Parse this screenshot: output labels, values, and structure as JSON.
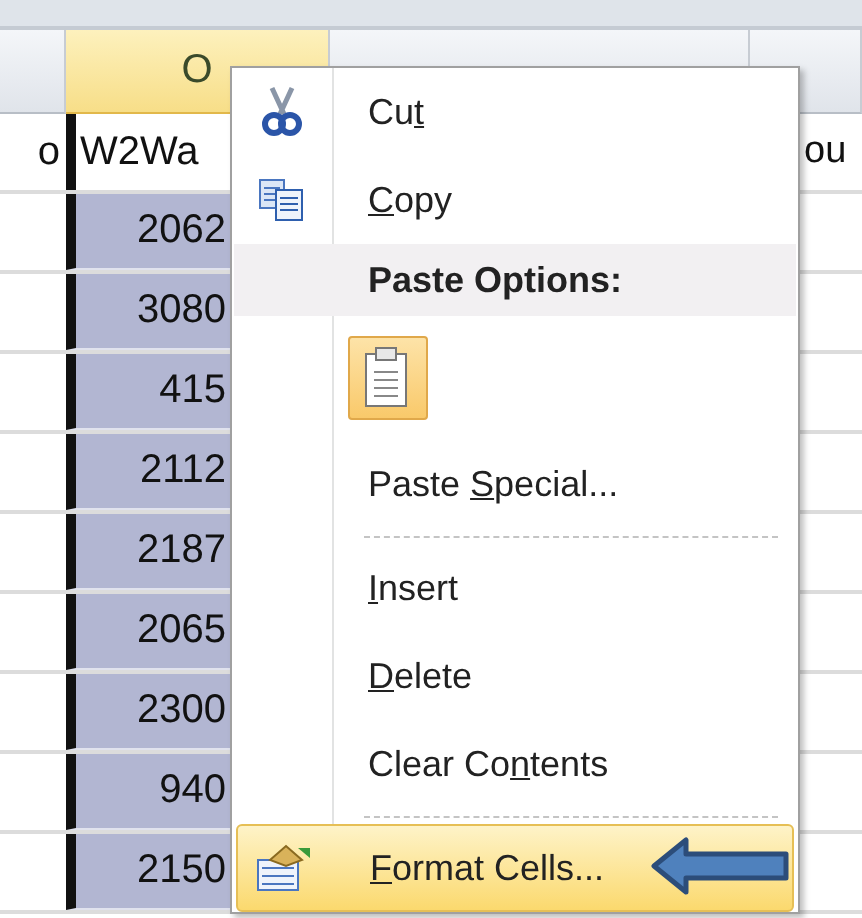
{
  "columns": [
    {
      "selected": false
    },
    {
      "label": "O",
      "selected": true
    },
    {
      "selected": false
    },
    {
      "selected": false
    }
  ],
  "rows": [
    {
      "column_1": "o",
      "column_2": "W2Wa",
      "column_4": "ou",
      "selected": false
    },
    {
      "column_2": "2062",
      "selected": true
    },
    {
      "column_2": "3080",
      "selected": true
    },
    {
      "column_2": "415",
      "selected": true
    },
    {
      "column_2": "2112",
      "selected": true
    },
    {
      "column_2": "2187",
      "selected": true
    },
    {
      "column_2": "2065",
      "selected": true
    },
    {
      "column_2": "2300",
      "selected": true
    },
    {
      "column_2": "940",
      "selected": true
    },
    {
      "column_2": "2150",
      "selected": true
    }
  ],
  "context_menu": {
    "items": [
      {
        "kind": "command",
        "before": "Cu",
        "key": "t",
        "highlighted": false,
        "arrow": false
      },
      {
        "kind": "command",
        "key": "C",
        "after": "opy",
        "highlighted": false,
        "arrow": false
      },
      {
        "kind": "heading",
        "label": "Paste Options:"
      },
      {
        "kind": "paste_buttons",
        "buttons": [
          {
            "highlighted": true
          }
        ]
      },
      {
        "kind": "command",
        "before": "Paste ",
        "key": "S",
        "after": "pecial...",
        "highlighted": false,
        "arrow": false
      },
      {
        "kind": "separator"
      },
      {
        "kind": "command",
        "key": "I",
        "after": "nsert",
        "highlighted": false,
        "arrow": false
      },
      {
        "kind": "command",
        "key": "D",
        "after": "elete",
        "highlighted": false,
        "arrow": false
      },
      {
        "kind": "command",
        "before": "Clear Co",
        "key": "n",
        "after": "tents",
        "highlighted": false,
        "arrow": false
      },
      {
        "kind": "separator"
      },
      {
        "kind": "command",
        "key": "F",
        "after": "ormat Cells...",
        "highlighted": true,
        "arrow": true
      }
    ]
  }
}
